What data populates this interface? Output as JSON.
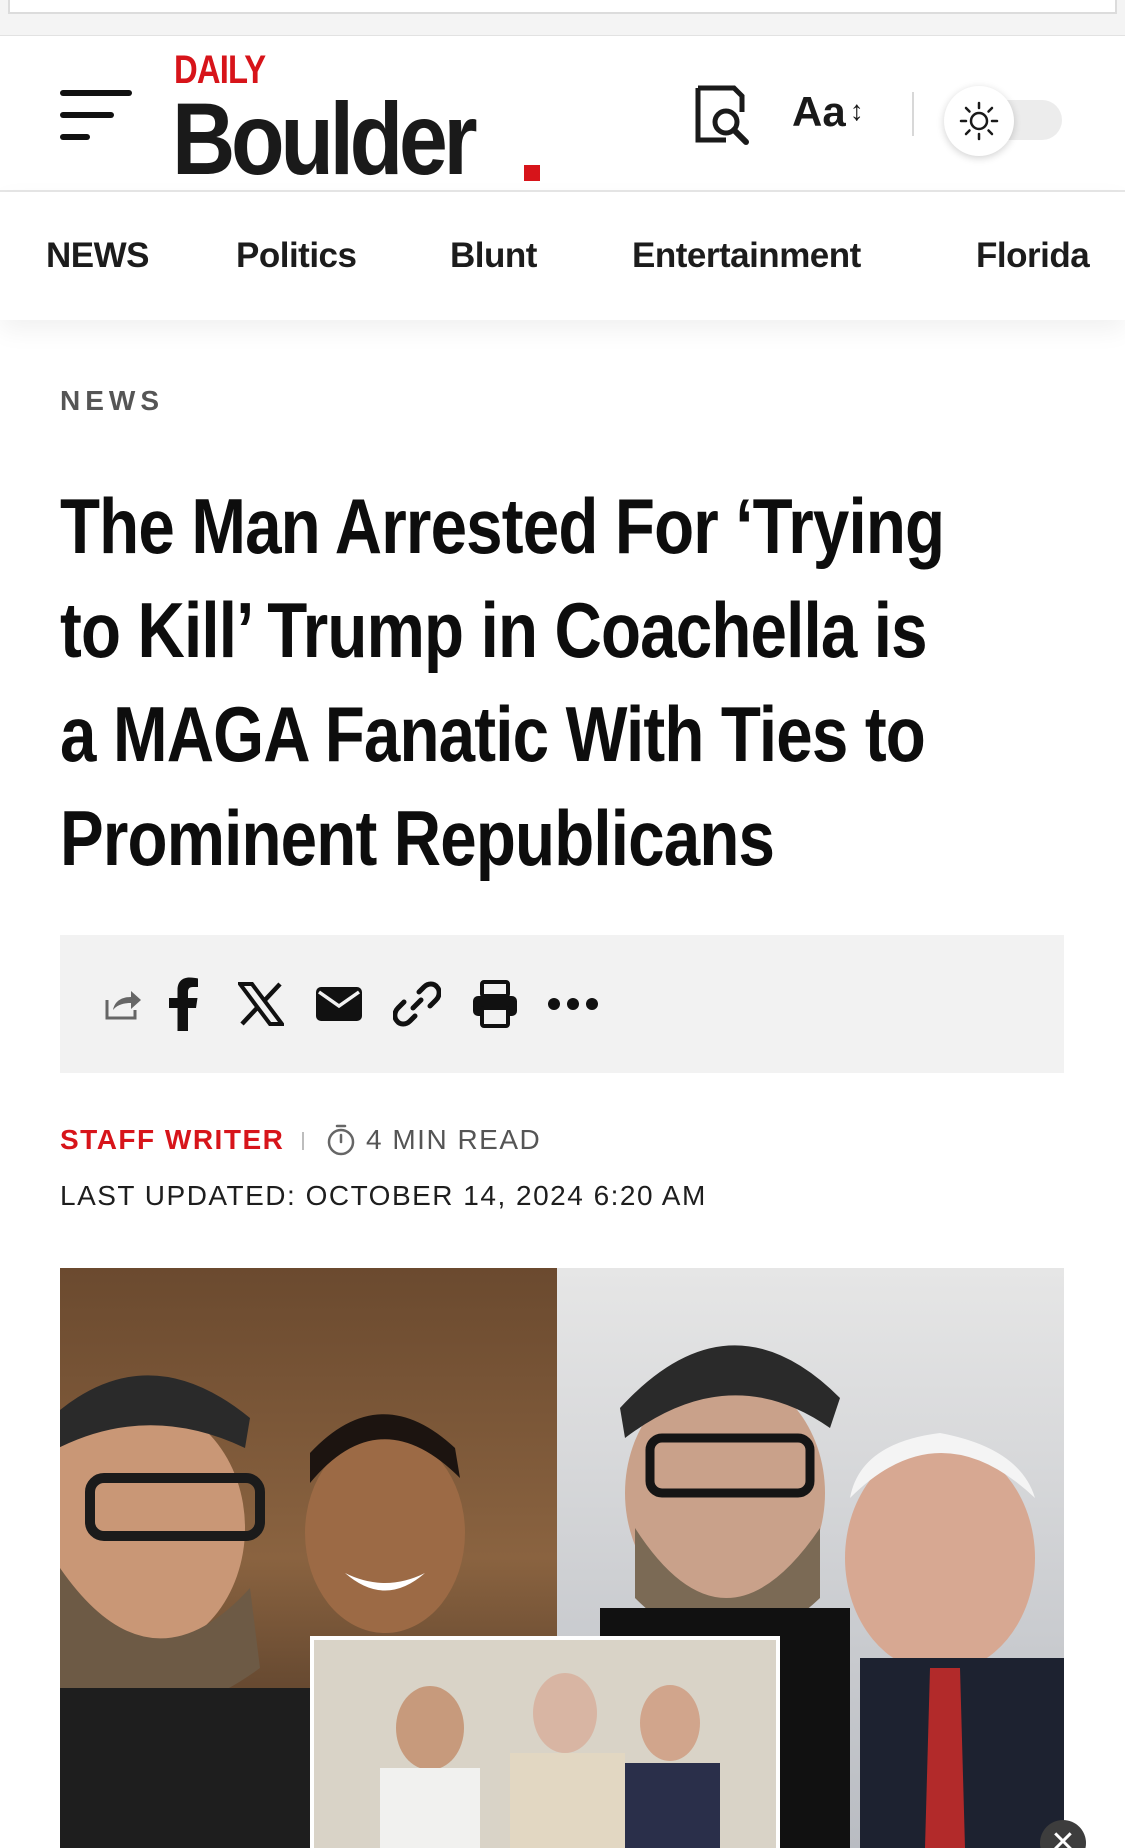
{
  "header": {
    "logo_small": "DAILY",
    "logo_big": "Boulder",
    "font_control_label": "Aa",
    "font_control_arrow": "↕",
    "brand_red": "#d7141a"
  },
  "nav": {
    "items": [
      {
        "label": "NEWS"
      },
      {
        "label": "Politics"
      },
      {
        "label": "Blunt"
      },
      {
        "label": "Entertainment"
      },
      {
        "label": "Florida"
      }
    ]
  },
  "article": {
    "category": "NEWS",
    "headline": "The Man Arrested For ‘Trying to Kill’ Trump in Coachella is a MAGA Fanatic With Ties to Prominent Republicans",
    "share_icons": [
      "share-icon",
      "facebook-icon",
      "x-icon",
      "email-icon",
      "link-icon",
      "print-icon",
      "more-icon"
    ],
    "author": "STAFF WRITER",
    "read_time": "4 MIN READ",
    "last_updated": "LAST UPDATED: OCTOBER 14, 2024 6:20 AM"
  },
  "overlay": {
    "close_symbol": "✕"
  }
}
